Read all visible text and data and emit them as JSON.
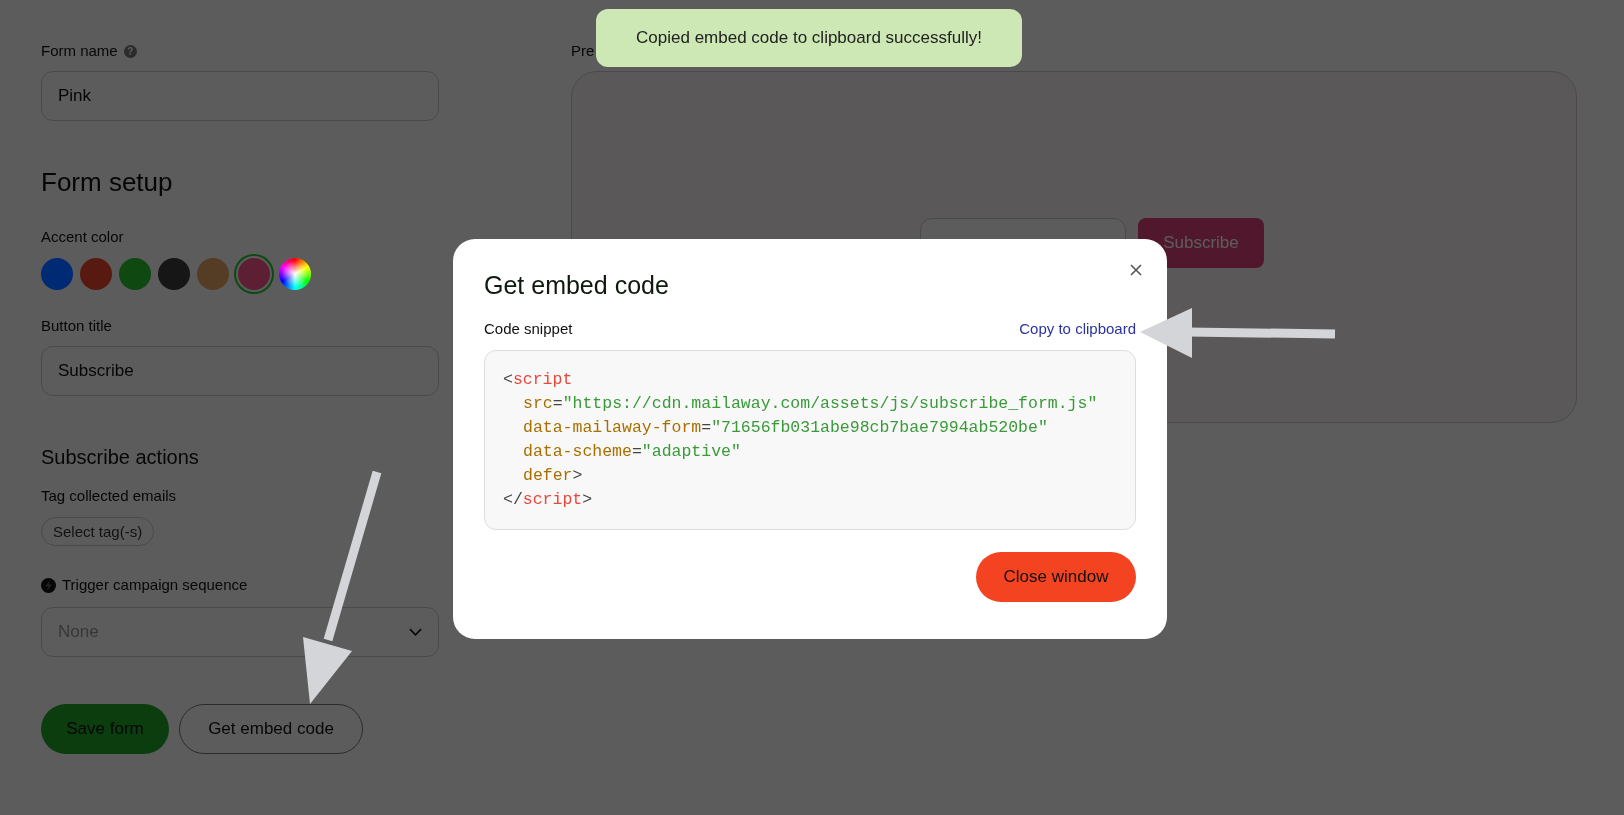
{
  "form_name": {
    "label": "Form name",
    "help_icon": "?",
    "value": "Pink"
  },
  "form_setup": {
    "heading": "Form setup",
    "accent_label": "Accent color",
    "swatches": [
      {
        "kind": "solid",
        "color": "#002a74",
        "selected": false
      },
      {
        "kind": "solid",
        "color": "#581a10",
        "selected": false
      },
      {
        "kind": "solid",
        "color": "#0f4810",
        "selected": false
      },
      {
        "kind": "solid",
        "color": "#161616",
        "selected": false
      },
      {
        "kind": "solid",
        "color": "#553d25",
        "selected": false
      },
      {
        "kind": "solid",
        "color": "#5c1f33",
        "selected": true
      },
      {
        "kind": "custom",
        "selected": false
      }
    ],
    "button_title_label": "Button title",
    "button_title_value": "Subscribe"
  },
  "subscribe_actions": {
    "heading": "Subscribe actions",
    "tag_label": "Tag collected emails",
    "tag_chip": "Select tag(-s)",
    "trigger_label": "Trigger campaign sequence",
    "trigger_value": "None"
  },
  "actions": {
    "save": "Save form",
    "embed": "Get embed code"
  },
  "preview": {
    "label": "Pre",
    "button": "Subscribe"
  },
  "toast": "Copied embed code to clipboard successfully!",
  "modal": {
    "title": "Get embed code",
    "snippet_label": "Code snippet",
    "copy_link": "Copy to clipboard",
    "code": [
      {
        "indented": false,
        "tokens": [
          {
            "kind": "punct",
            "text": "<"
          },
          {
            "kind": "tag",
            "text": "script"
          }
        ]
      },
      {
        "indented": true,
        "tokens": [
          {
            "kind": "attr",
            "text": "src"
          },
          {
            "kind": "punct",
            "text": "="
          },
          {
            "kind": "string",
            "text": "\"https://cdn.mailaway.com/assets/js/subscribe_form.js\""
          }
        ]
      },
      {
        "indented": true,
        "tokens": [
          {
            "kind": "attr",
            "text": "data-mailaway-form"
          },
          {
            "kind": "punct",
            "text": "="
          },
          {
            "kind": "string",
            "text": "\"71656fb031abe98cb7bae7994ab520be\""
          }
        ]
      },
      {
        "indented": true,
        "tokens": [
          {
            "kind": "attr",
            "text": "data-scheme"
          },
          {
            "kind": "punct",
            "text": "="
          },
          {
            "kind": "string",
            "text": "\"adaptive\""
          }
        ]
      },
      {
        "indented": true,
        "tokens": [
          {
            "kind": "attr",
            "text": "defer"
          },
          {
            "kind": "punct",
            "text": ">"
          }
        ]
      },
      {
        "indented": false,
        "tokens": [
          {
            "kind": "punct",
            "text": "</"
          },
          {
            "kind": "tag",
            "text": "script"
          },
          {
            "kind": "punct",
            "text": ">"
          }
        ]
      }
    ],
    "close_button": "Close window"
  }
}
